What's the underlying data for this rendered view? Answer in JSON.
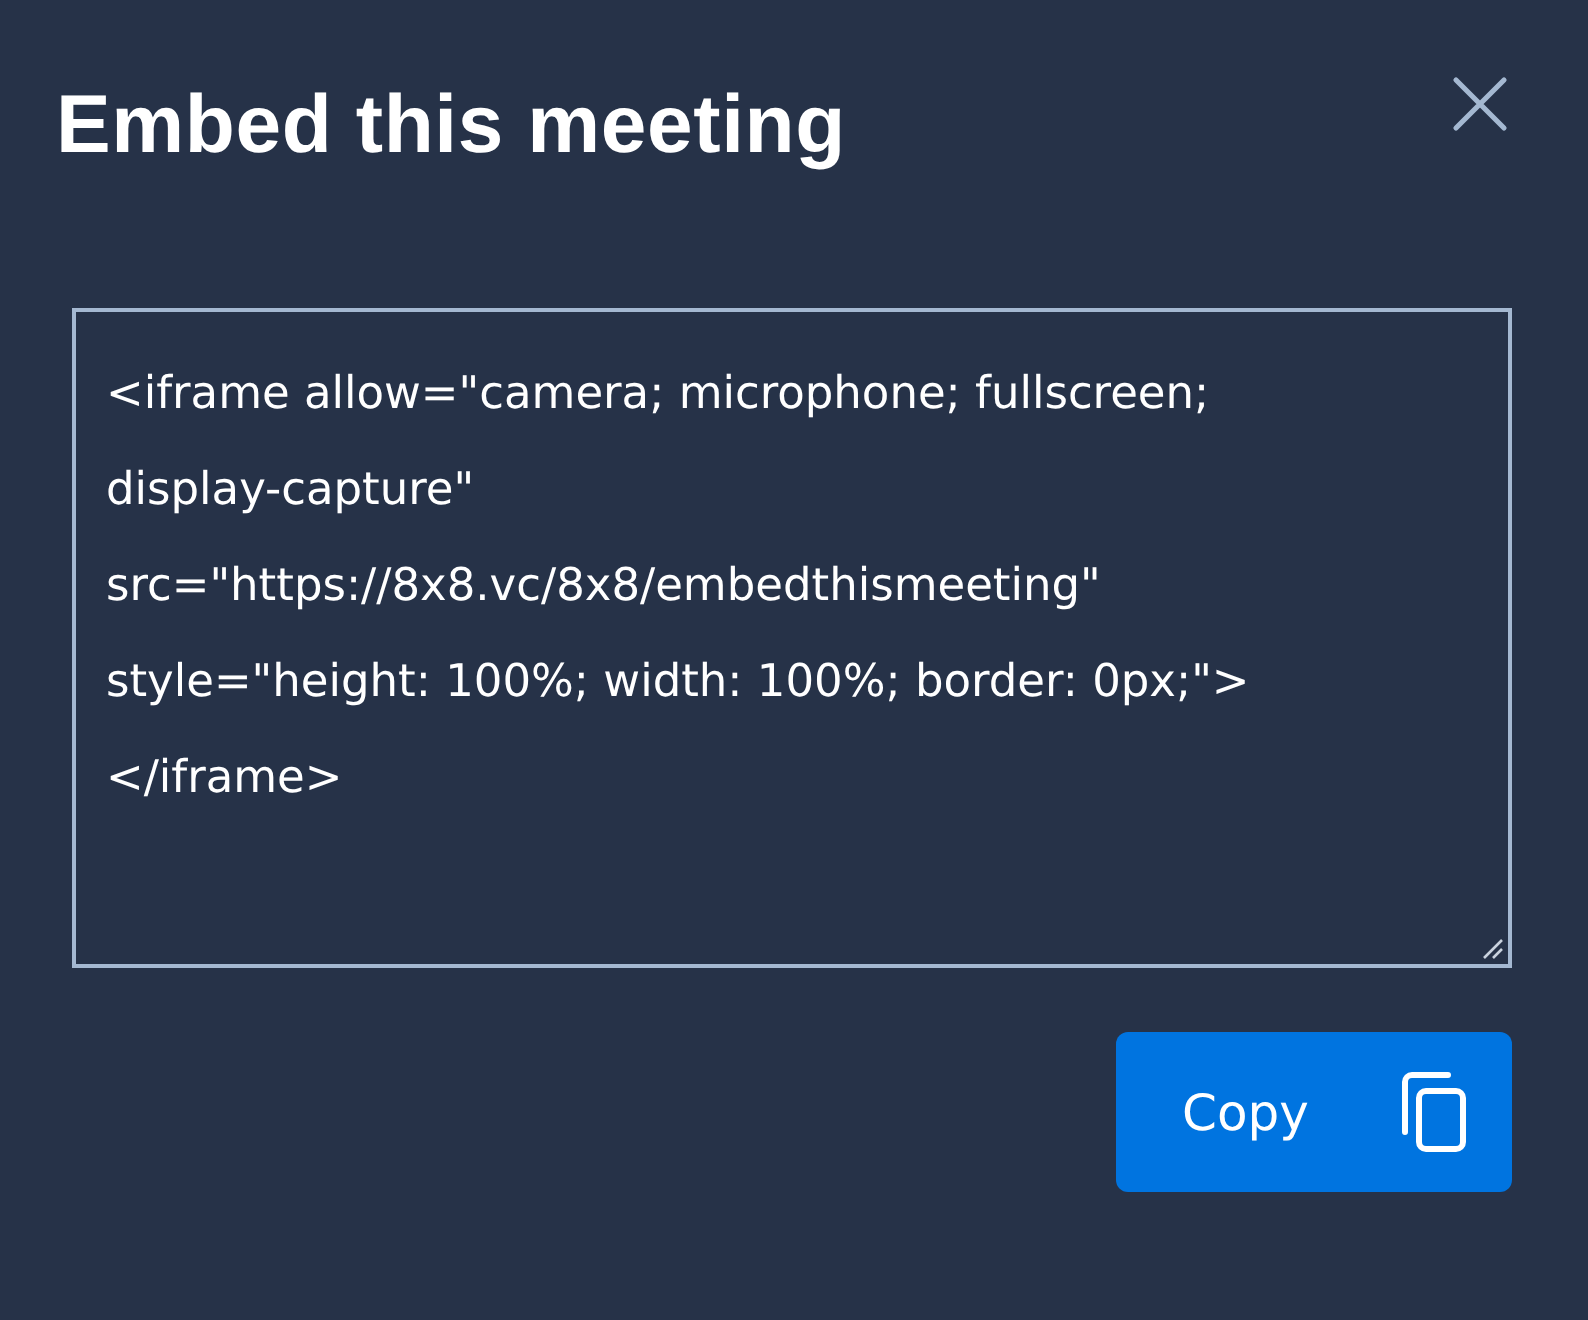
{
  "dialog": {
    "title": "Embed this meeting"
  },
  "embed_code": {
    "lines": [
      "<iframe allow=\"camera; microphone; fullscreen;",
      "display-capture\"",
      "src=\"https://8x8.vc/8x8/embedthismeeting\"",
      "style=\"height: 100%; width: 100%; border: 0px;\">",
      "</iframe>"
    ]
  },
  "copy_button": {
    "label": "Copy"
  }
}
